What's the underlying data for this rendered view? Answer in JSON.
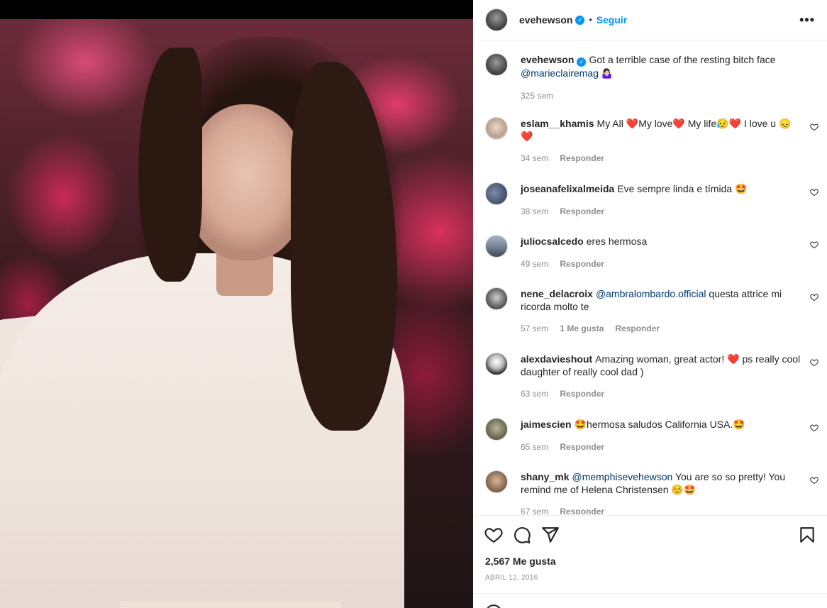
{
  "post_owner": {
    "username": "evehewson",
    "follow_label": "Seguir",
    "separator": "•",
    "more_label": "•••"
  },
  "caption": {
    "username": "evehewson",
    "text": "Got a terrible case of the resting bitch face",
    "mention": "@marieclairemag",
    "emoji": "🤷🏻‍♀️",
    "time": "325 sem"
  },
  "comments": [
    {
      "username": "eslam__khamis",
      "text": "My All ❤️My love❤️  My life😥❤️  I love u 😞",
      "text2": "❤️",
      "time": "34 sem",
      "reply": "Responder"
    },
    {
      "username": "joseanafelixalmeida",
      "text": "Eve sempre linda e tímida 🤩",
      "time": "38 sem",
      "reply": "Responder"
    },
    {
      "username": "juliocsalcedo",
      "text": "eres hermosa",
      "time": "49 sem",
      "reply": "Responder"
    },
    {
      "username": "nene_delacroix",
      "mention": "@ambralombardo.official",
      "text": "questa attrice mi ricorda molto te",
      "time": "57 sem",
      "likes": "1 Me gusta",
      "reply": "Responder"
    },
    {
      "username": "alexdavieshout",
      "text": "Amazing woman, great actor! ❤️  ps really cool daughter of really cool dad )",
      "time": "63 sem",
      "reply": "Responder"
    },
    {
      "username": "jaimescien",
      "text": "🤩hermosa saludos California USA.🤩",
      "time": "65 sem",
      "reply": "Responder"
    },
    {
      "username": "shany_mk",
      "mention": "@memphisevehewson",
      "text": "You are so so pretty! You remind me of Helena Christensen ☺️🤩",
      "time": "67 sem",
      "reply": "Responder"
    }
  ],
  "footer": {
    "likes": "2,567 Me gusta",
    "date": "ABRIL 12, 2016"
  },
  "icons": {
    "verified": "✓"
  }
}
